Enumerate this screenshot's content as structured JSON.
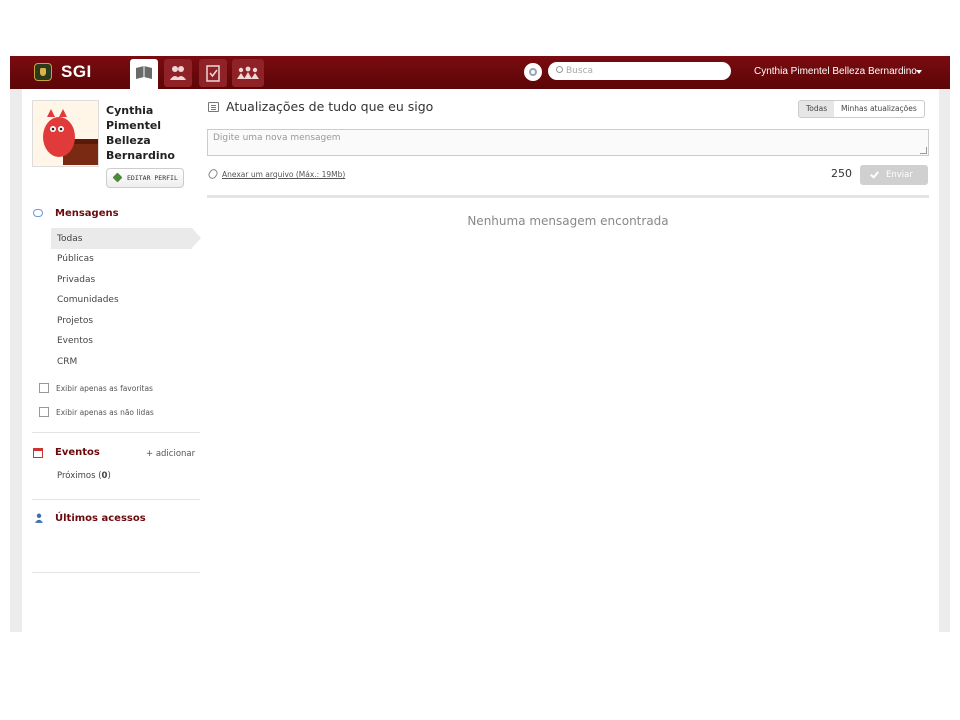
{
  "topbar": {
    "brand": "SGI",
    "nav": [
      {
        "icon": "book-icon",
        "active": true
      },
      {
        "icon": "groups-icon"
      },
      {
        "icon": "tasks-icon"
      },
      {
        "icon": "people-icon"
      }
    ],
    "search": {
      "placeholder": "Busca",
      "icon": "search-icon"
    },
    "user_name": "Cynthia Pimentel Belleza Bernardino"
  },
  "profile": {
    "name": "Cynthia Pimentel Belleza Bernardino",
    "edit_button": "EDITAR PERFIL"
  },
  "sidebar": {
    "messages": {
      "title": "Mensagens",
      "items": [
        "Todas",
        "Públicas",
        "Privadas",
        "Comunidades",
        "Projetos",
        "Eventos",
        "CRM"
      ],
      "active": "Todas"
    },
    "filters": [
      {
        "label": "Exibir apenas as favoritas",
        "checked": false
      },
      {
        "label": "Exibir apenas as não  lidas",
        "checked": false
      }
    ],
    "events": {
      "title": "Eventos",
      "add_label": "+ adicionar",
      "upcoming_label": "Próximos (",
      "upcoming_count": "0",
      "upcoming_close": ")"
    },
    "recent_access": {
      "title": "Últimos acessos"
    }
  },
  "main": {
    "title": "Atualizações de tudo que eu sigo",
    "filter_all": "Todas",
    "filter_mine": "Minhas atualizações",
    "message_placeholder": "Digite uma nova mensagem",
    "attach_label": "Anexar um arquivo (Máx.: 19Mb)",
    "char_count": "250",
    "send_label": "Enviar",
    "empty_message": "Nenhuma mensagem encontrada"
  },
  "colors": {
    "topbar": "#6a0a0e",
    "section_title": "#6b0a0e",
    "send_disabled": "#d0d0d0"
  }
}
